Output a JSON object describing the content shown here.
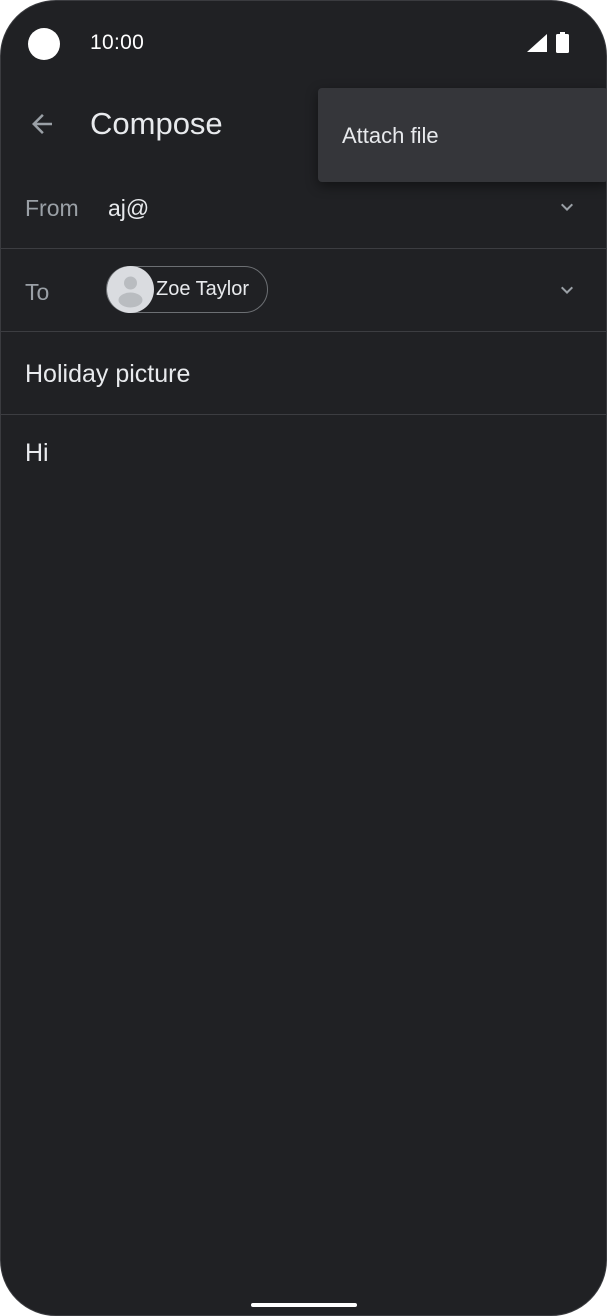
{
  "status_bar": {
    "time": "10:00",
    "icons": [
      "camera-cutout",
      "signal-icon",
      "battery-icon"
    ]
  },
  "app_bar": {
    "title": "Compose",
    "back_icon": "arrow-back-icon"
  },
  "form": {
    "from_label": "From",
    "from_value": "aj@",
    "to_label": "To",
    "to_recipient": "Zoe Taylor",
    "subject": "Holiday picture",
    "body": "Hi"
  },
  "menu": {
    "items": [
      {
        "label": "Attach file"
      }
    ]
  },
  "colors": {
    "background": "#202124",
    "menu_background": "#35363a",
    "label": "#9aa0a6",
    "text": "#e8eaed"
  }
}
